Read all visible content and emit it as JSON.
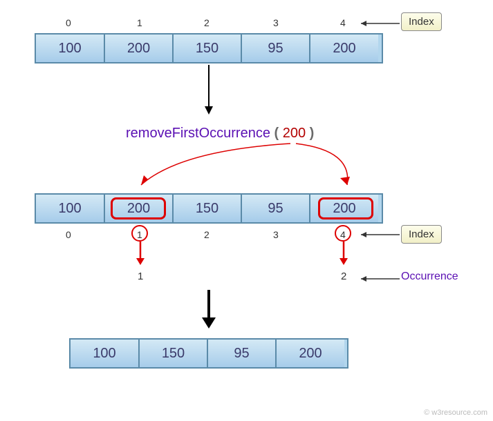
{
  "labels": {
    "index": "Index",
    "occurrence": "Occurrence",
    "copyright": "© w3resource.com"
  },
  "func": {
    "name": "removeFirstOccurrence",
    "arg": "200"
  },
  "array1": {
    "indices": [
      "0",
      "1",
      "2",
      "3",
      "4"
    ],
    "values": [
      "100",
      "200",
      "150",
      "95",
      "200"
    ]
  },
  "array2": {
    "indices": [
      "0",
      "1",
      "2",
      "3",
      "4"
    ],
    "values": [
      "100",
      "200",
      "150",
      "95",
      "200"
    ],
    "occurrence": [
      "1",
      "2"
    ]
  },
  "array3": {
    "values": [
      "100",
      "150",
      "95",
      "200"
    ]
  }
}
